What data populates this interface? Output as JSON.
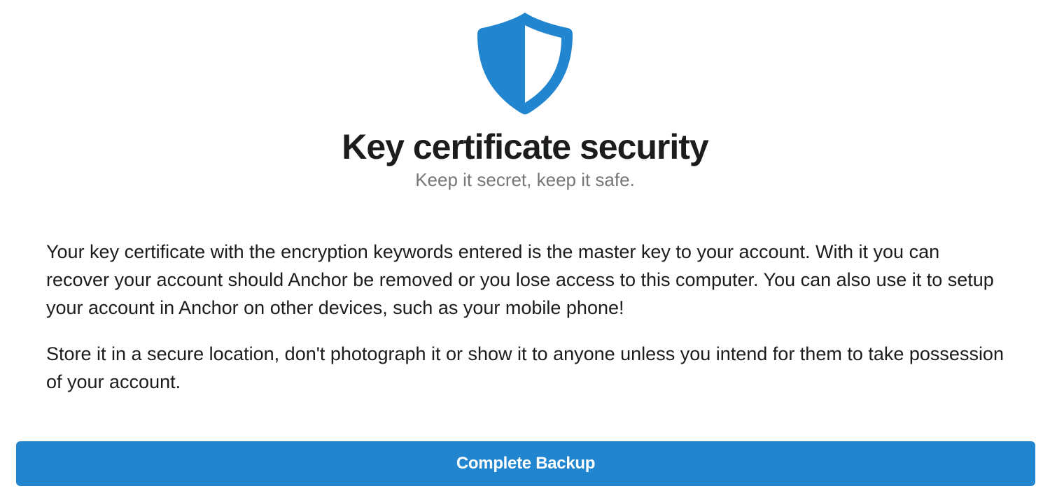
{
  "header": {
    "icon": "shield-icon",
    "title": "Key certificate security",
    "subtitle": "Keep it secret, keep it safe."
  },
  "content": {
    "paragraphs": [
      "Your key certificate with the encryption keywords entered is the master key to your account. With it you can recover your account should Anchor be removed or you lose access to this computer. You can also use it to setup your account in Anchor on other devices, such as your mobile phone!",
      "Store it in a secure location, don't photograph it or show it to anyone unless you intend for them to take possession of your account."
    ]
  },
  "actions": {
    "primary_label": "Complete Backup"
  },
  "colors": {
    "accent": "#2185d0",
    "title": "#1b1c1d",
    "subtitle": "#767676"
  }
}
